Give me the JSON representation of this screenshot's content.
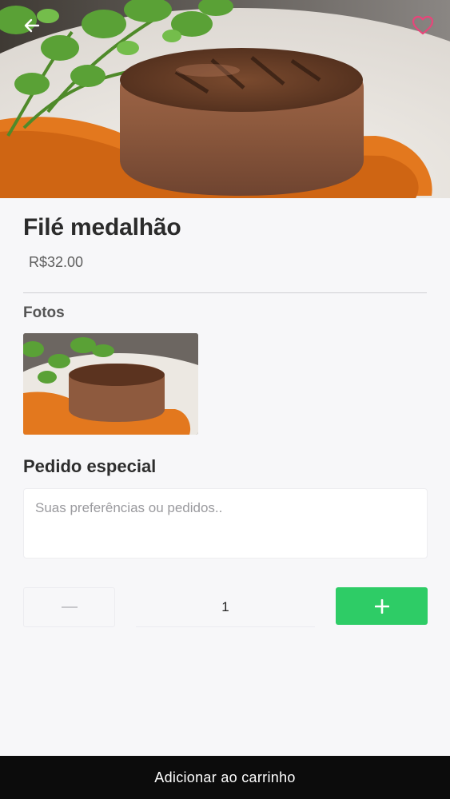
{
  "product": {
    "name": "Filé medalhão",
    "price": "R$32.00"
  },
  "photos": {
    "label": "Fotos"
  },
  "special_request": {
    "label": "Pedido especial",
    "placeholder": "Suas preferências ou pedidos..",
    "value": ""
  },
  "quantity": {
    "value": "1"
  },
  "cart": {
    "button_label": "Adicionar ao carrinho"
  },
  "icons": {
    "back": "arrow-left-icon",
    "favorite": "heart-outline-icon",
    "decrement": "minus-icon",
    "increment": "plus-icon"
  },
  "colors": {
    "accent_green": "#2ecc66",
    "favorite_pink": "#e8457a",
    "cart_bar": "#0c0c0c"
  }
}
